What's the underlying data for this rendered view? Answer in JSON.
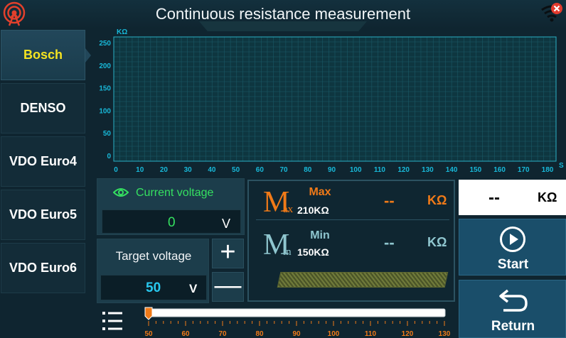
{
  "title": "Continuous resistance measurement",
  "brands": [
    {
      "label": "Bosch",
      "active": true
    },
    {
      "label": "DENSO",
      "active": false
    },
    {
      "label": "VDO Euro4",
      "active": false
    },
    {
      "label": "VDO Euro5",
      "active": false
    },
    {
      "label": "VDO Euro6",
      "active": false
    }
  ],
  "chart_data": {
    "type": "line",
    "ylabel": "KΩ",
    "xlabel": "S",
    "xlim": [
      0,
      180
    ],
    "ylim": [
      0,
      250
    ],
    "x_ticks": [
      "0",
      "10",
      "20",
      "30",
      "40",
      "50",
      "60",
      "70",
      "80",
      "90",
      "100",
      "110",
      "120",
      "130",
      "140",
      "150",
      "160",
      "170",
      "180"
    ],
    "y_ticks": [
      "0",
      "50",
      "100",
      "150",
      "200",
      "250"
    ],
    "grid": true,
    "series": []
  },
  "current_voltage": {
    "label": "Current voltage",
    "value": "0",
    "unit": "V"
  },
  "target_voltage": {
    "label": "Target voltage",
    "value": "50",
    "unit": "V"
  },
  "adjust": {
    "plus": "+",
    "minus": "—"
  },
  "max": {
    "big": "M",
    "sub": "ax",
    "name": "Max",
    "limit": "210KΩ",
    "value": "--",
    "unit": "KΩ"
  },
  "min": {
    "big": "M",
    "sub": "in",
    "name": "Min",
    "limit": "150KΩ",
    "value": "--",
    "unit": "KΩ"
  },
  "resistance": {
    "value": "--",
    "unit": "KΩ"
  },
  "buttons": {
    "start": "Start",
    "return": "Return"
  },
  "voltage_slider": {
    "min": 50,
    "max": 130,
    "value": 50,
    "labels": [
      "50",
      "60",
      "70",
      "80",
      "90",
      "100",
      "110",
      "120",
      "130"
    ]
  },
  "icons": {
    "logo": "signal-antenna-icon",
    "wifi": "wifi-off-icon",
    "eye": "eye-icon",
    "menu": "menu-icon",
    "play": "play-circle-icon",
    "return": "return-arrow-icon"
  },
  "colors": {
    "background": "#0f2530",
    "active_brand": "#f5e321",
    "chart_grid": "#1a6a74",
    "axis": "#18b8d8",
    "green": "#35e060",
    "cyan": "#28c8ee",
    "orange": "#f07a18",
    "min_teal": "#8fc6cf",
    "button": "#1a4e6a"
  }
}
